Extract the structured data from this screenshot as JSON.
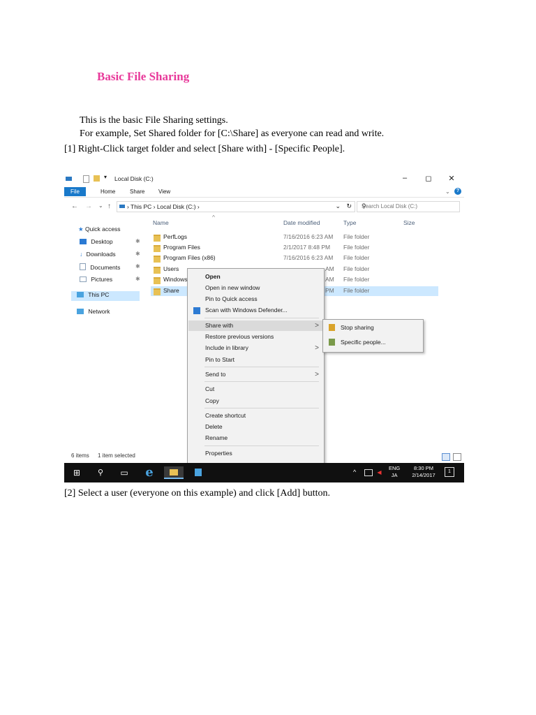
{
  "doc": {
    "title": "Basic File Sharing",
    "p1": "This is the basic File Sharing settings.",
    "p2": "For example, Set Shared folder for [C:\\Share] as everyone can read and write.",
    "p3": "[1] Right-Click target folder and select [Share with] - [Specific People].",
    "p4": "[2] Select a user (everyone on this example) and click [Add] button."
  },
  "window": {
    "title": "Local Disk (C:)",
    "minimize": "–",
    "maximize": "◻",
    "close": "✕",
    "help": "?",
    "ribbon_tabs": [
      "File",
      "Home",
      "Share",
      "View"
    ],
    "ribbon_expand": "⌄"
  },
  "address": {
    "back": "←",
    "forward": "→",
    "recent": "⌄",
    "up": "↑",
    "crumbs": "› This PC  ›  Local Disk (C:)  ›",
    "dropdown": "⌄",
    "refresh": "↻",
    "search_placeholder": "Search Local Disk (C:)",
    "search_icon": "⚲"
  },
  "nav": {
    "items": [
      {
        "label": "Quick access",
        "icon": "star-icon",
        "color": "#2a7ad3"
      },
      {
        "label": "Desktop",
        "icon": "desktop-icon",
        "color": "#2a7ad3",
        "pinned": true
      },
      {
        "label": "Downloads",
        "icon": "download-icon",
        "color": "#2a7ad3",
        "pinned": true
      },
      {
        "label": "Documents",
        "icon": "documents-icon",
        "color": "#8aa0b8",
        "pinned": true
      },
      {
        "label": "Pictures",
        "icon": "pictures-icon",
        "color": "#8aa0b8",
        "pinned": true
      },
      {
        "label": "This PC",
        "icon": "computer-icon",
        "color": "#4aa3df"
      },
      {
        "label": "Network",
        "icon": "network-icon",
        "color": "#4aa3df"
      }
    ],
    "pin": "✱"
  },
  "columns": {
    "name": "Name",
    "date": "Date modified",
    "type": "Type",
    "size": "Size",
    "sort_arrow": "^"
  },
  "files": [
    {
      "name": "PerfLogs",
      "date": "7/16/2016 6:23 AM",
      "type": "File folder"
    },
    {
      "name": "Program Files",
      "date": "2/1/2017 8:48 PM",
      "type": "File folder"
    },
    {
      "name": "Program Files (x86)",
      "date": "7/16/2016 6:23 AM",
      "type": "File folder"
    },
    {
      "name": "Users",
      "date": "AM",
      "type": "File folder"
    },
    {
      "name": "Windows",
      "date": "AM",
      "type": "File folder"
    },
    {
      "name": "Share",
      "date": "PM",
      "type": "File folder",
      "selected": true
    }
  ],
  "status": {
    "items": "6 items",
    "selected": "1 item selected"
  },
  "context_menu": {
    "open": "Open",
    "open_new_window": "Open in new window",
    "pin_quick": "Pin to Quick access",
    "scan": "Scan with Windows Defender...",
    "share_with": "Share with",
    "restore": "Restore previous versions",
    "include_library": "Include in library",
    "pin_start": "Pin to Start",
    "send_to": "Send to",
    "cut": "Cut",
    "copy": "Copy",
    "create_shortcut": "Create shortcut",
    "delete": "Delete",
    "rename": "Rename",
    "properties": "Properties",
    "arrow": ">"
  },
  "submenu": {
    "stop_sharing": "Stop sharing",
    "specific_people": "Specific people..."
  },
  "taskbar": {
    "start": "⊞",
    "search": "⚲",
    "task_view": "▭",
    "ie": "e",
    "tray_arrow": "^",
    "lang1": "ENG",
    "lang2": "JA",
    "time": "8:30 PM",
    "date": "2/14/2017",
    "notif": "1"
  }
}
